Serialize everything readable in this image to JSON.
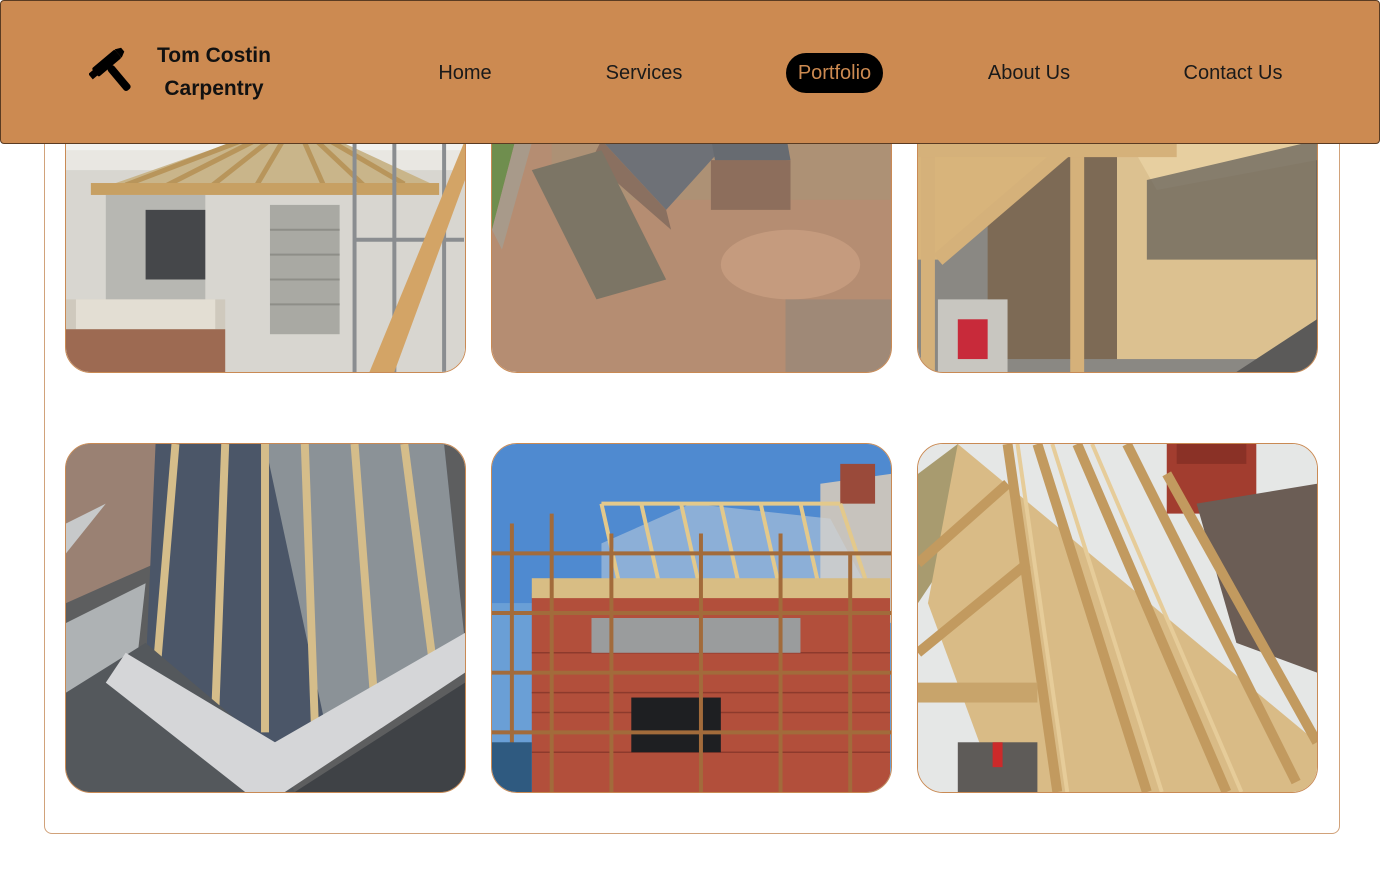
{
  "brand": {
    "line1": "Tom Costin",
    "line2": "Carpentry",
    "icon": "hammer-icon"
  },
  "nav": {
    "home": "Home",
    "services": "Services",
    "portfolio": "Portfolio",
    "about": "About Us",
    "contact": "Contact Us",
    "active": "Portfolio"
  },
  "colors": {
    "header_bg": "#cc8a51",
    "active_pill_bg": "#000000",
    "active_pill_text": "#cc8a51",
    "card_border": "#d1a27a"
  },
  "gallery": {
    "photos": [
      {
        "subject": "hip-roof-porch-frame"
      },
      {
        "subject": "aerial-barn-conversion-site"
      },
      {
        "subject": "timber-frame-boarding"
      },
      {
        "subject": "roof-membrane-battens"
      },
      {
        "subject": "roof-trusses-scaffolding"
      },
      {
        "subject": "roof-rafters-chimney"
      }
    ]
  }
}
